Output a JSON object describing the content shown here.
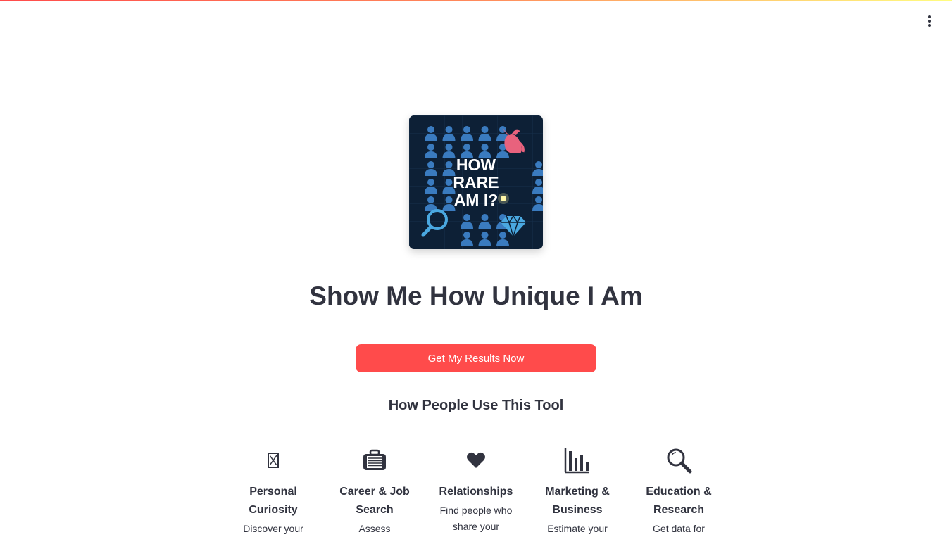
{
  "header": {
    "menu_icon": "kebab-menu-icon"
  },
  "hero": {
    "image_text": [
      "HOW",
      "RARE",
      "AM I?"
    ],
    "colors": {
      "background": "#0d2036",
      "people": "#3a7bbf",
      "unicorn": "#e8627d",
      "diamond": "#4aa8e0",
      "text": "#ffffff"
    }
  },
  "main": {
    "title": "Show Me How Unique I Am",
    "cta_label": "Get My Results Now",
    "section_title": "How People Use This Tool"
  },
  "uses": [
    {
      "icon": "hourglass-icon",
      "glyph": "⌛",
      "title": "Personal Curiosity",
      "desc": "Discover your"
    },
    {
      "icon": "briefcase-icon",
      "glyph": "",
      "title": "Career & Job Search",
      "desc": "Assess"
    },
    {
      "icon": "heart-icon",
      "glyph": "❤",
      "title": "Relationships",
      "desc": "Find people who share your"
    },
    {
      "icon": "bar-chart-icon",
      "glyph": "",
      "title": "Marketing & Business",
      "desc": "Estimate your"
    },
    {
      "icon": "magnifier-icon",
      "glyph": "",
      "title": "Education & Research",
      "desc": "Get data for"
    }
  ],
  "colors": {
    "accent": "#ff4b4b",
    "text": "#31333f"
  }
}
